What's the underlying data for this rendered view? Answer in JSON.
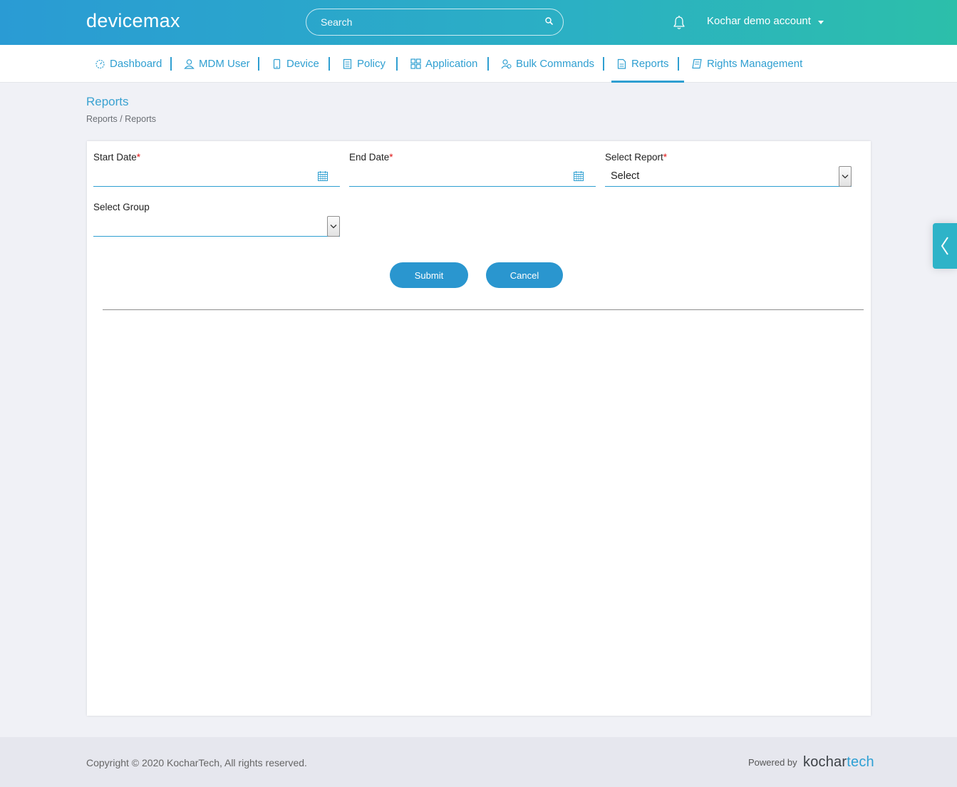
{
  "header": {
    "logo": "devicemax",
    "search_placeholder": "Search",
    "account_name": "Kochar demo account"
  },
  "nav": {
    "items": [
      {
        "label": "Dashboard",
        "icon": "dashboard-icon"
      },
      {
        "label": "MDM User",
        "icon": "user-icon"
      },
      {
        "label": "Device",
        "icon": "device-icon"
      },
      {
        "label": "Policy",
        "icon": "policy-icon"
      },
      {
        "label": "Application",
        "icon": "application-icon"
      },
      {
        "label": "Bulk Commands",
        "icon": "bulk-commands-icon"
      },
      {
        "label": "Reports",
        "icon": "reports-icon"
      },
      {
        "label": "Rights Management",
        "icon": "rights-management-icon"
      }
    ],
    "active": "Reports"
  },
  "page": {
    "title": "Reports",
    "breadcrumb": "Reports / Reports"
  },
  "form": {
    "start_date_label": "Start Date",
    "end_date_label": "End Date",
    "select_report_label": "Select Report",
    "select_report_value": "Select",
    "select_group_label": "Select Group",
    "select_group_value": "",
    "required_mark": "*",
    "submit_label": "Submit",
    "cancel_label": "Cancel"
  },
  "footer": {
    "copyright": "Copyright © 2020 KocharTech, All rights reserved.",
    "powered_by": "Powered by",
    "brand_part1": "kochar",
    "brand_part2": "tech"
  },
  "colors": {
    "accent": "#2f9fd1",
    "header_gradient_start": "#2a9bd4",
    "header_gradient_end": "#2cbfaa",
    "button": "#2a96cf",
    "required": "#e01717"
  }
}
